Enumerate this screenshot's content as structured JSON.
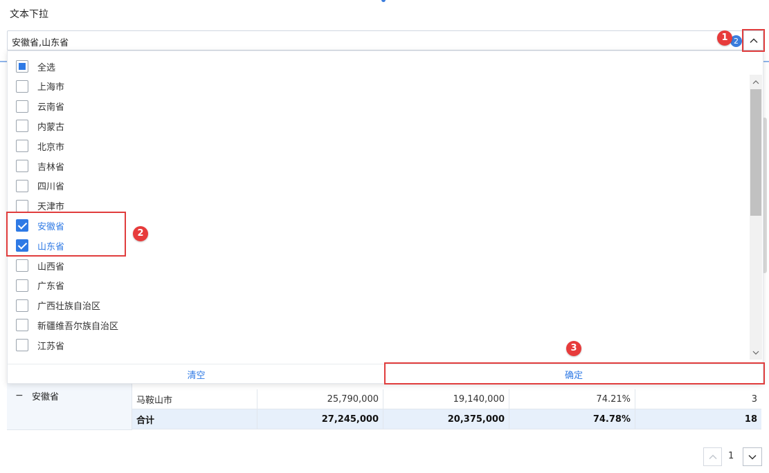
{
  "page": {
    "title": "文本下拉"
  },
  "combo": {
    "value": "安徽省,山东省",
    "selected_count": "2"
  },
  "options": [
    {
      "label": "全选",
      "state": "partial"
    },
    {
      "label": "上海市",
      "state": "unchecked"
    },
    {
      "label": "云南省",
      "state": "unchecked"
    },
    {
      "label": "内蒙古",
      "state": "unchecked"
    },
    {
      "label": "北京市",
      "state": "unchecked"
    },
    {
      "label": "吉林省",
      "state": "unchecked"
    },
    {
      "label": "四川省",
      "state": "unchecked"
    },
    {
      "label": "天津市",
      "state": "unchecked"
    },
    {
      "label": "安徽省",
      "state": "checked"
    },
    {
      "label": "山东省",
      "state": "checked"
    },
    {
      "label": "山西省",
      "state": "unchecked"
    },
    {
      "label": "广东省",
      "state": "unchecked"
    },
    {
      "label": "广西壮族自治区",
      "state": "unchecked"
    },
    {
      "label": "新疆维吾尔族自治区",
      "state": "unchecked"
    },
    {
      "label": "江苏省",
      "state": "unchecked"
    }
  ],
  "footer": {
    "clear": "清空",
    "confirm": "确定"
  },
  "annotations": {
    "step1": "1",
    "step2": "2",
    "step3": "3"
  },
  "table": {
    "group_label": "安徽省",
    "rows": [
      {
        "name": "马鞍山市",
        "c1": "25,790,000",
        "c2": "19,140,000",
        "c3": "74.21%",
        "c4": "3"
      },
      {
        "name": "合计",
        "c1": "27,245,000",
        "c2": "20,375,000",
        "c3": "74.78%",
        "c4": "18"
      }
    ]
  },
  "pager": {
    "page": "1"
  },
  "colors": {
    "accent": "#2f7ae5",
    "highlight": "#e03c3c",
    "badge": "#e73b3b"
  }
}
